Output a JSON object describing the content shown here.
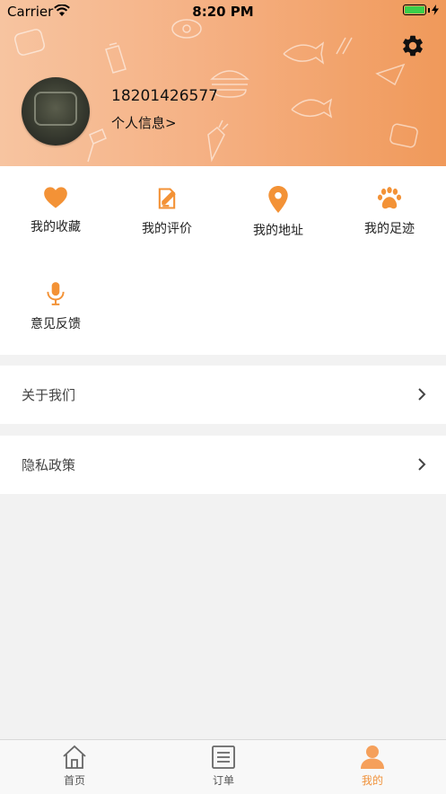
{
  "status_bar": {
    "carrier": "Carrier",
    "time": "8:20 PM"
  },
  "profile": {
    "phone": "18201426577",
    "info_link": "个人信息>"
  },
  "colors": {
    "accent": "#f39236",
    "header_start": "#f7c4a0",
    "header_end": "#f0995a"
  },
  "features": [
    {
      "label": "我的收藏",
      "icon": "heart-icon"
    },
    {
      "label": "我的评价",
      "icon": "edit-note-icon"
    },
    {
      "label": "我的地址",
      "icon": "location-pin-icon"
    },
    {
      "label": "我的足迹",
      "icon": "paw-icon"
    },
    {
      "label": "意见反馈",
      "icon": "microphone-icon"
    }
  ],
  "menu": [
    {
      "label": "关于我们",
      "icon": "chevron-right-icon"
    },
    {
      "label": "隐私政策",
      "icon": "chevron-right-icon"
    }
  ],
  "tabs": [
    {
      "label": "首页",
      "icon": "home-icon"
    },
    {
      "label": "订单",
      "icon": "order-list-icon"
    },
    {
      "label": "我的",
      "icon": "person-icon",
      "active": true
    }
  ]
}
